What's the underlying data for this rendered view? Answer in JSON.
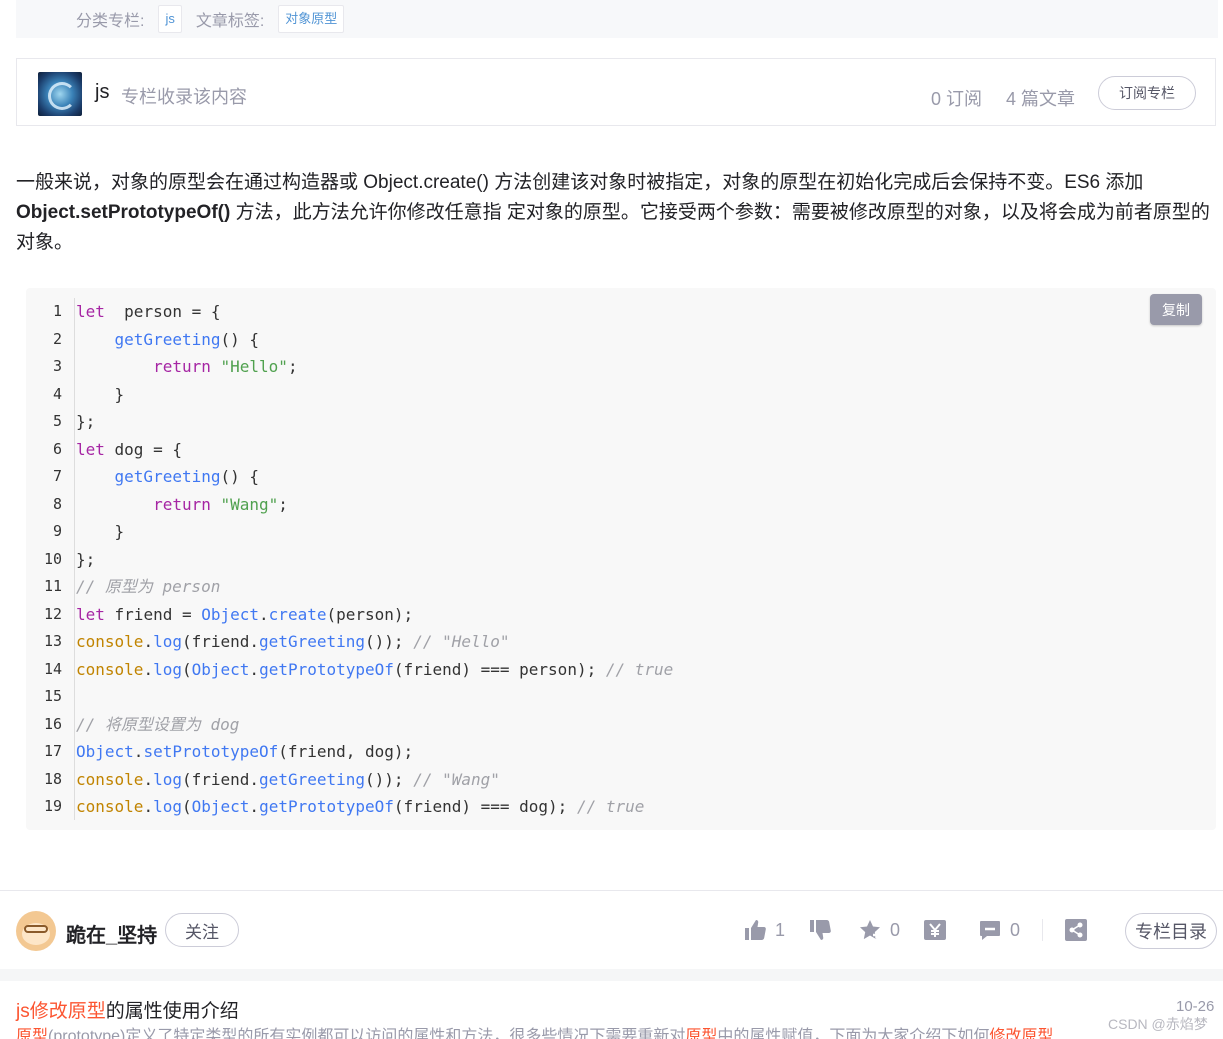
{
  "tags": {
    "category_label": "分类专栏:",
    "category_value": "js",
    "tag_label": "文章标签:",
    "tag_value": "对象原型"
  },
  "column": {
    "name": "js",
    "description": "专栏收录该内容",
    "subscribers": "0 订阅",
    "articles": "4 篇文章",
    "subscribe_button": "订阅专栏"
  },
  "paragraph": {
    "part1": "一般来说，对象的原型会在通过构造器或 Object.create() 方法创建该对象时被指定，对象的原型在初始化完成后会保持不变。ES6 添加 ",
    "bold": "Object.setPrototypeOf()",
    "part2": " 方法，此方法允许你修改任意指 定对象的原型。它接受两个参数：需要被修改原型的对象，以及将会成为前者原型的对象。"
  },
  "code": {
    "copy_button": "复制",
    "line_numbers": [
      "1",
      "2",
      "3",
      "4",
      "5",
      "6",
      "7",
      "8",
      "9",
      "10",
      "11",
      "12",
      "13",
      "14",
      "15",
      "16",
      "17",
      "18",
      "19"
    ],
    "lines": [
      [
        [
          "kw",
          "let"
        ],
        [
          "",
          "  person = {"
        ]
      ],
      [
        [
          "",
          "    "
        ],
        [
          "fn",
          "getGreeting"
        ],
        [
          "",
          "() {"
        ]
      ],
      [
        [
          "",
          "        "
        ],
        [
          "kw",
          "return"
        ],
        [
          "",
          " "
        ],
        [
          "st",
          "\"Hello\""
        ],
        [
          "",
          ";"
        ]
      ],
      [
        [
          "",
          "    }"
        ]
      ],
      [
        [
          "",
          "};"
        ]
      ],
      [
        [
          "kw",
          "let"
        ],
        [
          "",
          " dog = {"
        ]
      ],
      [
        [
          "",
          "    "
        ],
        [
          "fn",
          "getGreeting"
        ],
        [
          "",
          "() {"
        ]
      ],
      [
        [
          "",
          "        "
        ],
        [
          "kw",
          "return"
        ],
        [
          "",
          " "
        ],
        [
          "st",
          "\"Wang\""
        ],
        [
          "",
          ";"
        ]
      ],
      [
        [
          "",
          "    }"
        ]
      ],
      [
        [
          "",
          "};"
        ]
      ],
      [
        [
          "cm",
          "// 原型为 person"
        ]
      ],
      [
        [
          "kw",
          "let"
        ],
        [
          "",
          " friend = "
        ],
        [
          "fn",
          "Object"
        ],
        [
          "",
          "."
        ],
        [
          "fn",
          "create"
        ],
        [
          "",
          "(person);"
        ]
      ],
      [
        [
          "bi",
          "console"
        ],
        [
          "",
          "."
        ],
        [
          "fn",
          "log"
        ],
        [
          "",
          "(friend."
        ],
        [
          "fn",
          "getGreeting"
        ],
        [
          "",
          "()); "
        ],
        [
          "cm",
          "// \"Hello\""
        ]
      ],
      [
        [
          "bi",
          "console"
        ],
        [
          "",
          "."
        ],
        [
          "fn",
          "log"
        ],
        [
          "",
          "("
        ],
        [
          "fn",
          "Object"
        ],
        [
          "",
          "."
        ],
        [
          "fn",
          "getPrototypeOf"
        ],
        [
          "",
          "(friend) === person); "
        ],
        [
          "cm",
          "// true"
        ]
      ],
      [
        [
          "",
          ""
        ]
      ],
      [
        [
          "cm",
          "// 将原型设置为 dog"
        ]
      ],
      [
        [
          "fn",
          "Object"
        ],
        [
          "",
          "."
        ],
        [
          "fn",
          "setPrototypeOf"
        ],
        [
          "",
          "(friend, dog);"
        ]
      ],
      [
        [
          "bi",
          "console"
        ],
        [
          "",
          "."
        ],
        [
          "fn",
          "log"
        ],
        [
          "",
          "(friend."
        ],
        [
          "fn",
          "getGreeting"
        ],
        [
          "",
          "()); "
        ],
        [
          "cm",
          "// \"Wang\""
        ]
      ],
      [
        [
          "bi",
          "console"
        ],
        [
          "",
          "."
        ],
        [
          "fn",
          "log"
        ],
        [
          "",
          "("
        ],
        [
          "fn",
          "Object"
        ],
        [
          "",
          "."
        ],
        [
          "fn",
          "getPrototypeOf"
        ],
        [
          "",
          "(friend) === dog); "
        ],
        [
          "cm",
          "// true"
        ]
      ]
    ]
  },
  "author": {
    "name": "跪在_坚持",
    "follow_button": "关注",
    "likes": "1",
    "favorites": "0",
    "comments": "0",
    "toc_button": "专栏目录"
  },
  "related": {
    "title_highlight": "js修改原型",
    "title_rest": "的属性使用介绍",
    "date": "10-26",
    "snippet_h1": "原型",
    "snippet_1": "(prototype)定义了特定类型的所有实例都可以访问的属性和方法，很多些情况下需要重新对",
    "snippet_h2": "原型",
    "snippet_2": "中的属性赋值，下面为大家介绍下如何",
    "snippet_h3": "修改原型",
    "watermark": "CSDN @赤焰梦"
  },
  "colors": {
    "accent": "#fc5531",
    "muted": "#999aaa",
    "link": "#5094d5"
  }
}
